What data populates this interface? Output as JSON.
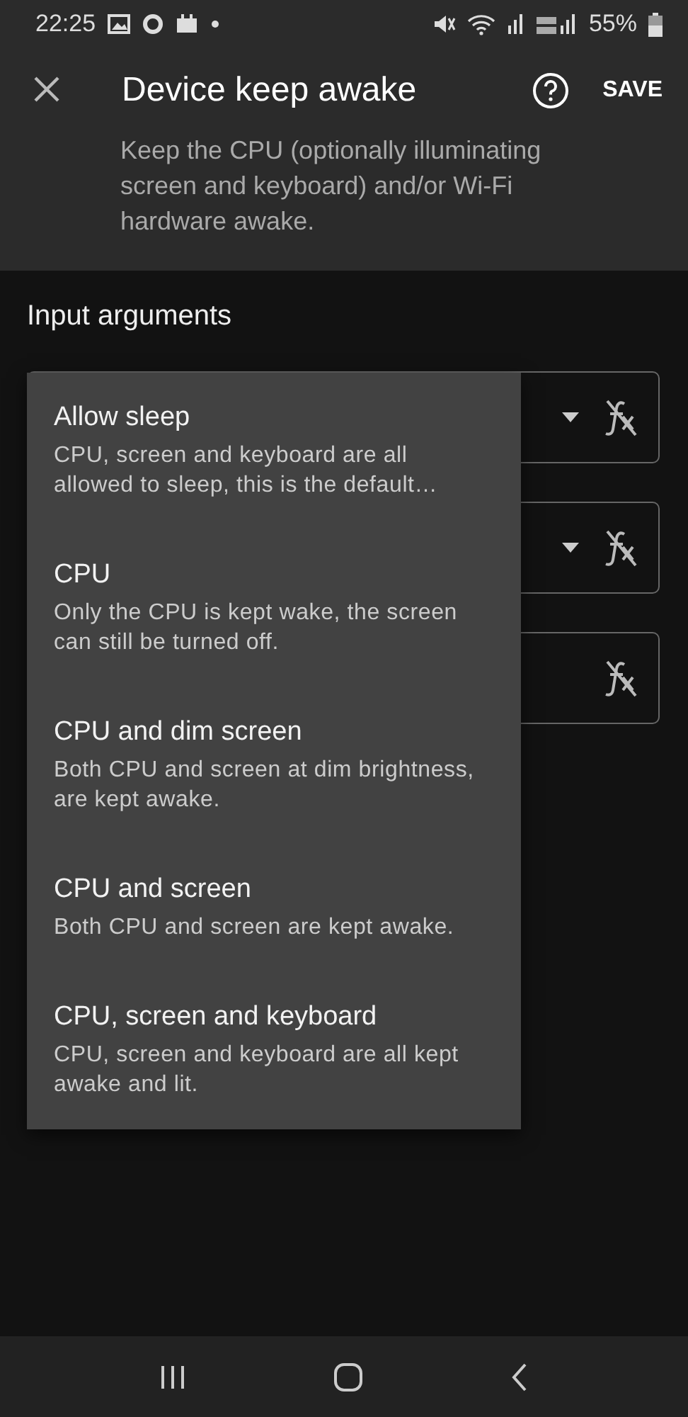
{
  "status_bar": {
    "time": "22:25",
    "battery": "55%"
  },
  "app_bar": {
    "title": "Device keep awake",
    "action": "SAVE",
    "description": "Keep the CPU (optionally illuminating screen and keyboard) and/or Wi-Fi hardware awake."
  },
  "section": {
    "title": "Input arguments"
  },
  "fields": [
    {
      "kind": "dropdown"
    },
    {
      "kind": "dropdown"
    },
    {
      "kind": "text"
    }
  ],
  "menu": {
    "items": [
      {
        "title": "Allow sleep",
        "description": "CPU, screen and keyboard are all allowed to sleep, this is the default…"
      },
      {
        "title": "CPU",
        "description": "Only the CPU is kept wake, the screen can still be turned off."
      },
      {
        "title": "CPU and dim screen",
        "description": "Both CPU and screen at dim brightness, are kept awake."
      },
      {
        "title": "CPU and screen",
        "description": "Both CPU and screen are kept awake."
      },
      {
        "title": "CPU, screen and keyboard",
        "description": "CPU, screen and keyboard are all kept awake and lit."
      }
    ]
  }
}
